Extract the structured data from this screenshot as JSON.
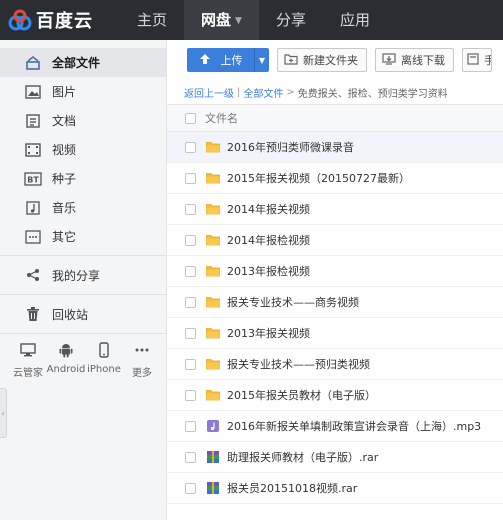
{
  "app": {
    "brand": "百度云",
    "nav": [
      {
        "label": "主页",
        "active": false
      },
      {
        "label": "网盘",
        "active": true
      },
      {
        "label": "分享",
        "active": false
      },
      {
        "label": "应用",
        "active": false
      }
    ]
  },
  "sidebar": {
    "items": [
      {
        "label": "全部文件",
        "icon": "all-files-icon",
        "active": true
      },
      {
        "label": "图片",
        "icon": "image-icon"
      },
      {
        "label": "文档",
        "icon": "document-icon"
      },
      {
        "label": "视频",
        "icon": "video-icon"
      },
      {
        "label": "种子",
        "icon": "bt-icon"
      },
      {
        "label": "音乐",
        "icon": "music-icon"
      },
      {
        "label": "其它",
        "icon": "other-icon"
      },
      {
        "label": "我的分享",
        "icon": "share-icon"
      },
      {
        "label": "回收站",
        "icon": "trash-icon"
      }
    ],
    "bt_icon_text": "BT",
    "devices": [
      {
        "label": "云管家",
        "icon": "desktop-icon"
      },
      {
        "label": "Android",
        "icon": "android-icon"
      },
      {
        "label": "iPhone",
        "icon": "iphone-icon"
      },
      {
        "label": "更多",
        "icon": "more-icon"
      }
    ]
  },
  "toolbar": {
    "upload_label": "上传",
    "new_folder_label": "新建文件夹",
    "offline_download_label": "离线下载",
    "cut_label": "手"
  },
  "breadcrumb": {
    "back": "返回上一级",
    "root": "全部文件",
    "current": "免费报关、报检、预归类学习资料"
  },
  "list_header": {
    "filename_label": "文件名"
  },
  "files": [
    {
      "name": "2016年预归类师微课录音",
      "type": "folder",
      "hover": true
    },
    {
      "name": "2015年报关视频（20150727最新）",
      "type": "folder"
    },
    {
      "name": "2014年报关视频",
      "type": "folder"
    },
    {
      "name": "2014年报检视频",
      "type": "folder"
    },
    {
      "name": "2013年报检视频",
      "type": "folder"
    },
    {
      "name": "报关专业技术——商务视频",
      "type": "folder"
    },
    {
      "name": "2013年报关视频",
      "type": "folder"
    },
    {
      "name": "报关专业技术——预归类视频",
      "type": "folder"
    },
    {
      "name": "2015年报关员教材（电子版）",
      "type": "folder"
    },
    {
      "name": "2016年新报关单填制政策宣讲会录音（上海）.mp3",
      "type": "audio"
    },
    {
      "name": "助理报关师教材（电子版）.rar",
      "type": "rar"
    },
    {
      "name": "报关员20151018视频.rar",
      "type": "rar"
    }
  ],
  "colors": {
    "topbar": "#2b2d33",
    "accent": "#3a7fdc",
    "folder": "#f5bd3a"
  }
}
